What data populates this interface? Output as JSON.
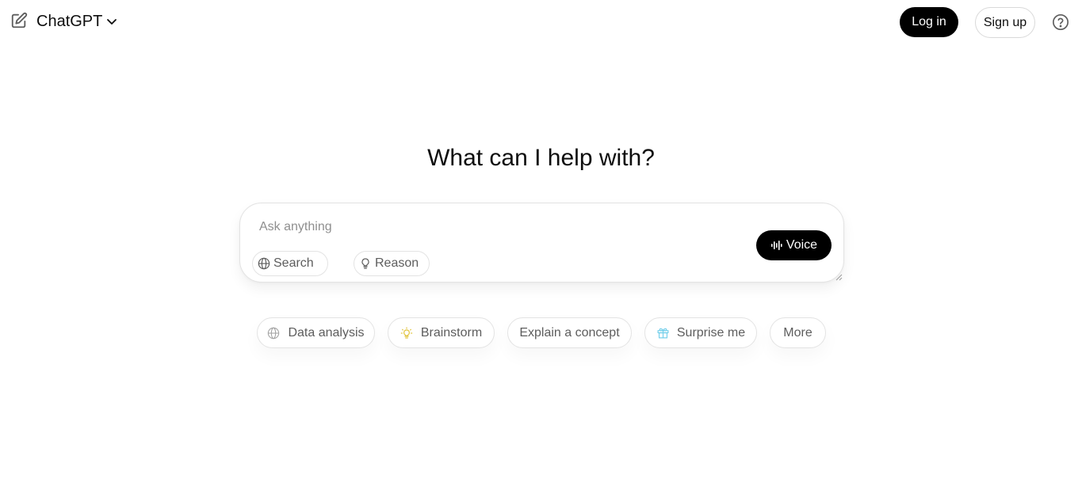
{
  "header": {
    "model_name": "ChatGPT",
    "login_label": "Log in",
    "signup_label": "Sign up",
    "icons": [
      "new-chat-icon",
      "chevron-down-icon",
      "help-icon"
    ]
  },
  "main": {
    "headline": "What can I help with?",
    "composer": {
      "placeholder": "Ask anything",
      "value": "",
      "tools": [
        {
          "label": "Search",
          "icon": "globe-icon"
        },
        {
          "label": "Reason",
          "icon": "lightbulb-icon"
        }
      ],
      "voice_label": "Voice",
      "voice_icon": "soundwave-icon"
    },
    "suggestions": [
      {
        "label": "Data analysis",
        "icon": "globe-icon",
        "icon_color": "#a3a3a3"
      },
      {
        "label": "Brainstorm",
        "icon": "lightbulb-icon",
        "icon_color": "#e2c541"
      },
      {
        "label": "Explain a concept",
        "icon": ""
      },
      {
        "label": "Surprise me",
        "icon": "gift-icon",
        "icon_color": "#76d0eb"
      },
      {
        "label": "More",
        "icon": ""
      }
    ]
  },
  "colors": {
    "primary_button": "#000000",
    "text": "#0d0d0d",
    "muted_text": "#5d5d5d",
    "border": "#e3e3e3"
  }
}
